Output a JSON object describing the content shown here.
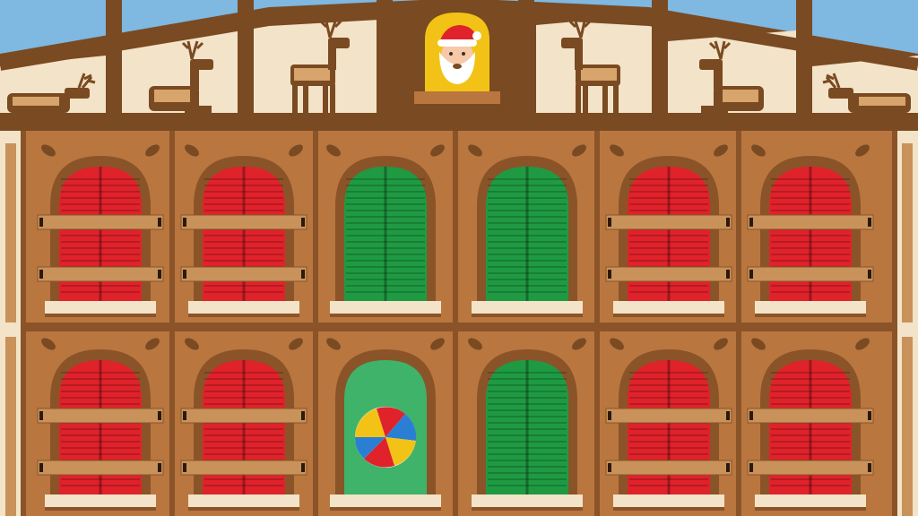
{
  "scene": {
    "colors": {
      "sky": "#7fb8e0",
      "roof_beam": "#7a4a22",
      "roof_panel": "#f3e3c8",
      "facade": "#b9763f",
      "facade_dark": "#8a5428",
      "leaf": "#7a4a22",
      "shutter_red": "#e0222b",
      "shutter_green": "#1f9a43",
      "opened_window_bg": "#3fb36a",
      "plank": "#c9925a",
      "sill": "#f3e3c8",
      "santa_window": "#f2c316"
    },
    "santa": {
      "icon": "santa-icon"
    },
    "reindeer": [
      {
        "pose": "lying",
        "facing": "right"
      },
      {
        "pose": "sitting",
        "facing": "right"
      },
      {
        "pose": "standing",
        "facing": "right"
      },
      {
        "pose": "standing",
        "facing": "left"
      },
      {
        "pose": "sitting",
        "facing": "left"
      },
      {
        "pose": "lying",
        "facing": "left"
      }
    ],
    "windows": [
      {
        "row": 1,
        "col": 1,
        "state": "locked-red"
      },
      {
        "row": 1,
        "col": 2,
        "state": "locked-red"
      },
      {
        "row": 1,
        "col": 3,
        "state": "closed-green"
      },
      {
        "row": 1,
        "col": 4,
        "state": "closed-green"
      },
      {
        "row": 1,
        "col": 5,
        "state": "locked-red"
      },
      {
        "row": 1,
        "col": 6,
        "state": "locked-red"
      },
      {
        "row": 2,
        "col": 1,
        "state": "locked-red"
      },
      {
        "row": 2,
        "col": 2,
        "state": "locked-red"
      },
      {
        "row": 2,
        "col": 3,
        "state": "open",
        "contents": "beach-ball-icon"
      },
      {
        "row": 2,
        "col": 4,
        "state": "closed-green"
      },
      {
        "row": 2,
        "col": 5,
        "state": "locked-red"
      },
      {
        "row": 2,
        "col": 6,
        "state": "locked-red"
      }
    ]
  }
}
